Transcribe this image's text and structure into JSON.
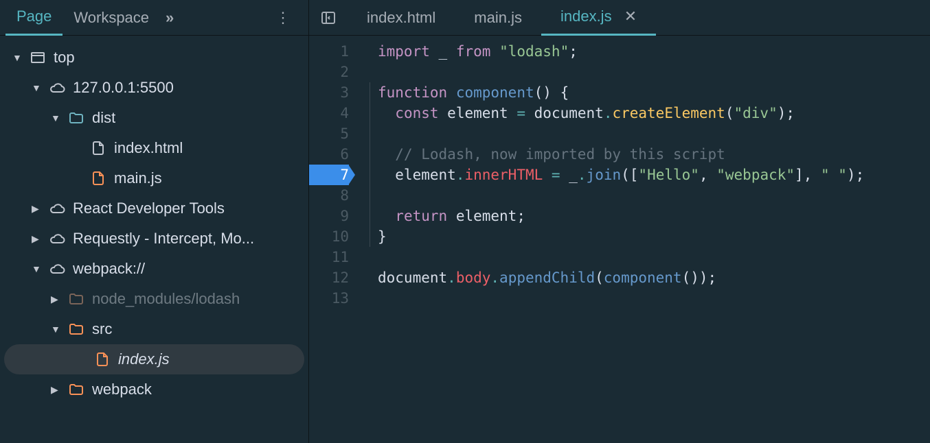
{
  "leftTabs": {
    "page": "Page",
    "workspace": "Workspace"
  },
  "editorTabs": {
    "t0": "index.html",
    "t1": "main.js",
    "t2": "index.js",
    "close": "✕"
  },
  "tree": {
    "top": "top",
    "host": "127.0.0.1:5500",
    "dist": "dist",
    "indexhtml": "index.html",
    "mainjs": "main.js",
    "rdt": "React Developer Tools",
    "req": "Requestly - Intercept, Mo...",
    "webpack": "webpack://",
    "node_modules": "node_modules/lodash",
    "src": "src",
    "indexjs": "index.js",
    "wpfolder": "webpack"
  },
  "lineNumbers": [
    "1",
    "2",
    "3",
    "4",
    "5",
    "6",
    "7",
    "8",
    "9",
    "10",
    "11",
    "12",
    "13"
  ],
  "breakpointLine": 7,
  "code": {
    "l1": {
      "import": "import",
      "under": "_",
      "from": "from",
      "str": "\"lodash\"",
      "semi": ";"
    },
    "l3": {
      "func": "function",
      "name": "component",
      "paren": "()",
      "brace": "{"
    },
    "l4": {
      "const": "const",
      "elem": "element",
      "eq": "=",
      "doc": "document",
      "dot": ".",
      "ce": "createElement",
      "open": "(",
      "div": "\"div\"",
      "close": ")",
      "semi": ";"
    },
    "l6": {
      "cmt": "// Lodash, now imported by this script"
    },
    "l7": {
      "elem": "element",
      "dot1": ".",
      "inner": "innerHTML",
      "eq": "=",
      "under": "_",
      "dot2": ".",
      "join": "join",
      "open": "([",
      "hello": "\"Hello\"",
      "comma": ",",
      "wp": "\"webpack\"",
      "close": "],",
      "space": "\" \"",
      "end": ");"
    },
    "l9": {
      "ret": "return",
      "elem": "element",
      "semi": ";"
    },
    "l10": {
      "brace": "}"
    },
    "l12": {
      "doc": "document",
      "dot1": ".",
      "body": "body",
      "dot2": ".",
      "append": "appendChild",
      "open": "(",
      "comp": "component",
      "paren": "()",
      "close": ")",
      "semi": ";"
    }
  }
}
